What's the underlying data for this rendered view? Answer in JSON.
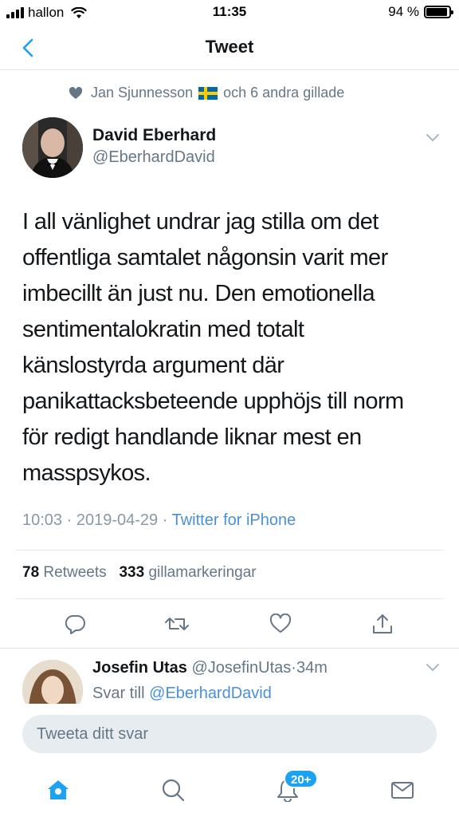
{
  "status_bar": {
    "carrier": "hallon",
    "time": "11:35",
    "battery_percent": "94 %",
    "battery_level": 0.94
  },
  "nav": {
    "title": "Tweet"
  },
  "social_context": {
    "text_before": "Jan Sjunnesson",
    "text_after": "och 6 andra gillade"
  },
  "author": {
    "name": "David Eberhard",
    "handle": "@EberhardDavid"
  },
  "tweet": {
    "lines": [
      "I all vänlighet undrar jag stilla om det",
      "offentliga samtalet någonsin varit mer",
      "imbecillt än just nu. Den emotionella",
      "sentimentalokratin med totalt",
      "känslostyrda argument där",
      "panikattacksbeteende upphöjs till norm",
      "för redigt handlande liknar mest en",
      "masspsykos."
    ],
    "time": "10:03",
    "date": "2019-04-29",
    "separator": "·",
    "source": "Twitter for iPhone"
  },
  "stats": {
    "retweets_count": "78",
    "retweets_label": "Retweets",
    "likes_count": "333",
    "likes_label": "gillamarkeringar"
  },
  "actions": [
    "reply-icon",
    "retweet-icon",
    "like-icon",
    "share-icon"
  ],
  "reply": {
    "name": "Josefin Utas",
    "handle": "@JosefinUtas",
    "separator": "·",
    "age": "34m",
    "reply_to_label": "Svar till",
    "reply_to_handle": "@EberhardDavid"
  },
  "compose": {
    "placeholder": "Tweeta ditt svar"
  },
  "tab_bar": {
    "notifications_badge": "20+",
    "tabs": [
      "home-icon",
      "search-icon",
      "notifications-icon",
      "messages-icon"
    ]
  },
  "colors": {
    "accent": "#1da1f2",
    "link": "#4a90d9",
    "secondary_text": "#657786",
    "divider": "#e1e8ed"
  }
}
